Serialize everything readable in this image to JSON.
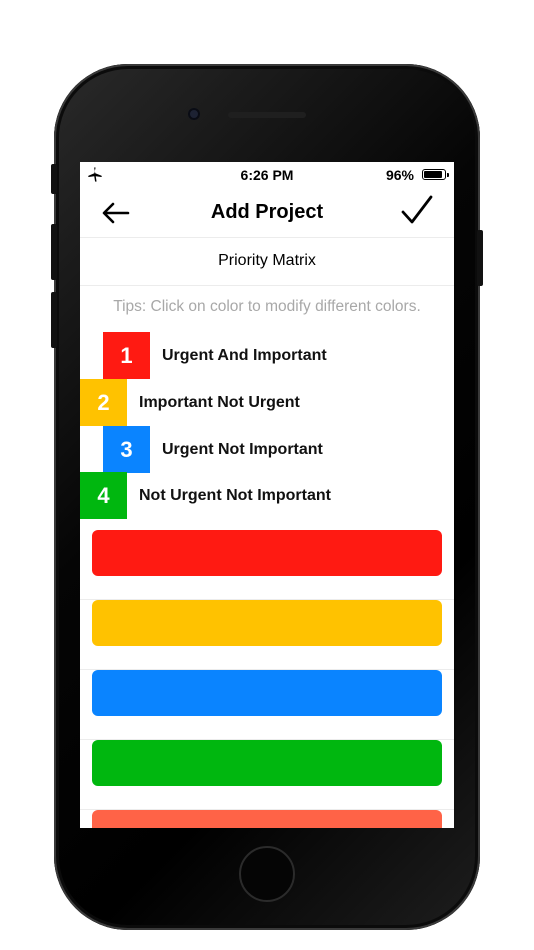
{
  "status_bar": {
    "time": "6:26 PM",
    "battery_percent": "96%",
    "battery_level": 0.96,
    "airplane_icon": "airplane-icon"
  },
  "nav": {
    "title": "Add Project",
    "back_icon": "arrow-left-icon",
    "done_icon": "checkmark-icon"
  },
  "section": {
    "title": "Priority Matrix"
  },
  "tips": "Tips: Click on color to modify different colors.",
  "legend": [
    {
      "number": "1",
      "label": "Urgent And Important",
      "color": "#ff1a12"
    },
    {
      "number": "2",
      "label": "Important Not Urgent",
      "color": "#ffc200"
    },
    {
      "number": "3",
      "label": "Urgent Not Important",
      "color": "#0a84ff"
    },
    {
      "number": "4",
      "label": "Not Urgent Not Important",
      "color": "#00b70f"
    }
  ],
  "color_options": [
    {
      "color": "#ff1a12"
    },
    {
      "color": "#ffc200"
    },
    {
      "color": "#0a84ff"
    },
    {
      "color": "#00b70f"
    },
    {
      "color": "#ff6347"
    }
  ],
  "device": {
    "frame_color": "#000000"
  }
}
